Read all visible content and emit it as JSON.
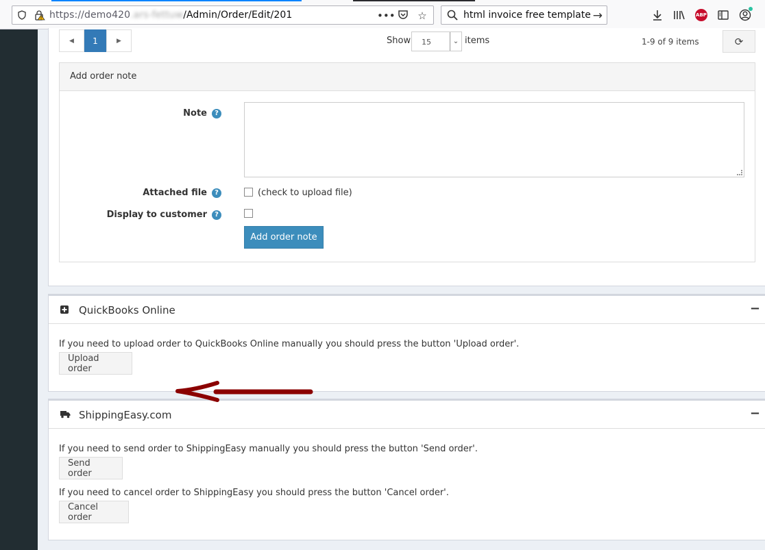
{
  "browser": {
    "url_prefix": "https://demo420",
    "url_redacted": ".ars-fettuw",
    "url_suffix": "/Admin/Order/Edit/201",
    "search_text": "html invoice free template",
    "abp_label": "ABP"
  },
  "pager": {
    "prev": "◀",
    "current_page": "1",
    "next": "▶",
    "show_label": "Show",
    "page_size": "15",
    "items_label": "items",
    "range_text": "1-9 of 9 items"
  },
  "order_note": {
    "header": "Add order note",
    "note_label": "Note",
    "attached_file_label": "Attached file",
    "attached_file_hint": "(check to upload file)",
    "display_to_customer_label": "Display to customer",
    "add_button": "Add order note",
    "note_value": ""
  },
  "quickbooks": {
    "title": "QuickBooks Online",
    "description": "If you need to upload order to QuickBooks Online manually you should press the button 'Upload order'.",
    "upload_button": "Upload order"
  },
  "shippingeasy": {
    "title": "ShippingEasy.com",
    "send_description": "If you need to send order to ShippingEasy manually you should press the button 'Send order'.",
    "send_button": "Send order",
    "cancel_description": "If you need to cancel order to ShippingEasy you should press the button 'Cancel order'.",
    "cancel_button": "Cancel order"
  },
  "colors": {
    "primary": "#3c8dbc",
    "sidebar": "#222d32",
    "arrow": "#8b0000"
  }
}
